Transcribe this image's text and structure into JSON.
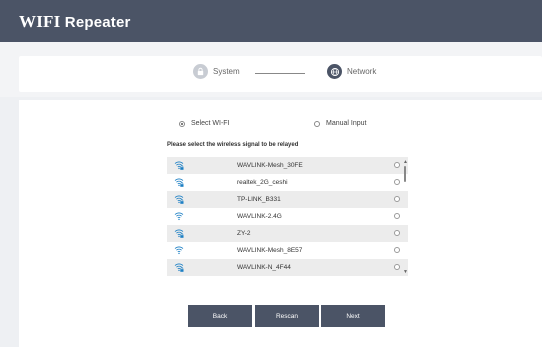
{
  "header": {
    "title_main": "WIFI",
    "title_rest": " Repeater"
  },
  "steps": {
    "system": "System",
    "network": "Network"
  },
  "mode": {
    "select_label": "Select WI-FI",
    "manual_label": "Manual Input",
    "selected": "select"
  },
  "prompt": "Please select the wireless signal to be relayed",
  "networks": [
    {
      "ssid": "WAVLINK-Mesh_30FE",
      "secured": true
    },
    {
      "ssid": "realtek_2G_ceshi",
      "secured": true
    },
    {
      "ssid": "TP-LINK_B331",
      "secured": true
    },
    {
      "ssid": "WAVLINK-2.4G",
      "secured": false
    },
    {
      "ssid": "ZY-2",
      "secured": true
    },
    {
      "ssid": "WAVLINK-Mesh_8E57",
      "secured": false
    },
    {
      "ssid": "WAVLINK-N_4F44",
      "secured": true
    }
  ],
  "buttons": {
    "back": "Back",
    "rescan": "Rescan",
    "next": "Next"
  },
  "colors": {
    "header": "#4b5466",
    "button": "#4b5466",
    "row_alt": "#ececec"
  }
}
